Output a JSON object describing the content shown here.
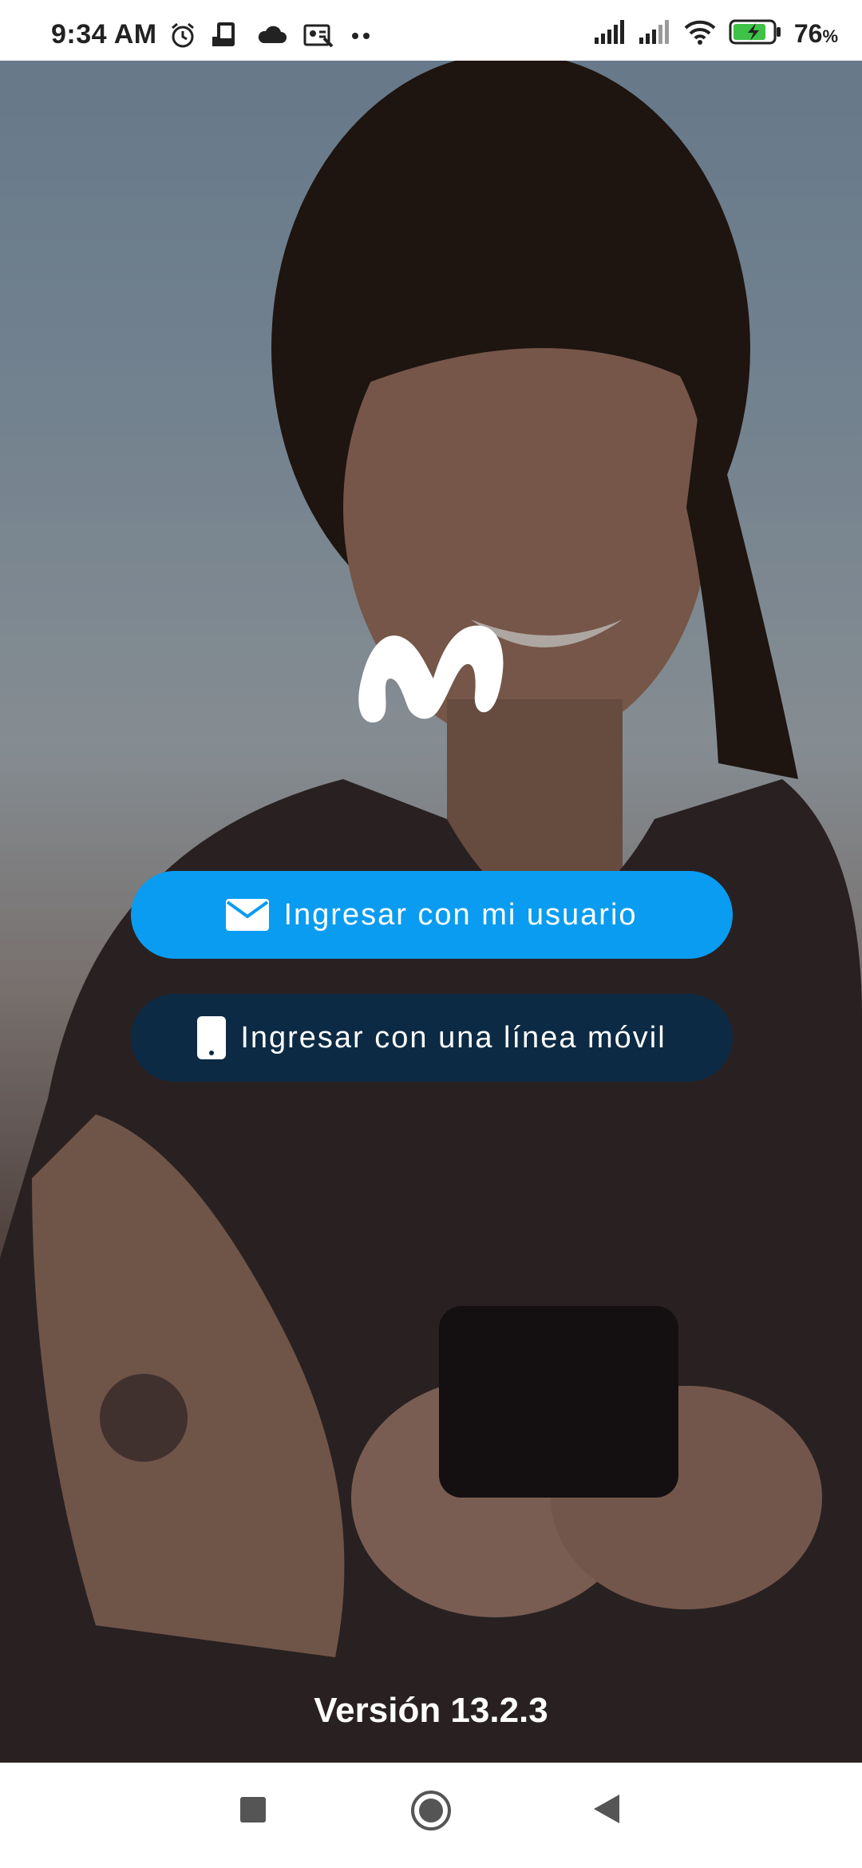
{
  "status_bar": {
    "time": "9:34 AM",
    "battery_percent": "76",
    "battery_unit": "%",
    "icons_left": [
      "alarm-icon",
      "phone-cast-icon",
      "cloud-icon",
      "contact-card-icon",
      "more-dots-icon"
    ],
    "icons_right": [
      "signal-icon",
      "signal-icon-2",
      "wifi-icon",
      "battery-charging-icon"
    ]
  },
  "app": {
    "logo": "movistar-m-logo",
    "buttons": {
      "user_login": "Ingresar con mi usuario",
      "line_login": "Ingresar con una línea móvil"
    },
    "version": "Versión 13.2.3"
  },
  "colors": {
    "primary_button": "#0a9cf0",
    "secondary_button": "#0c2a44"
  },
  "nav_bar": {
    "items": [
      "recent-apps-square-icon",
      "home-circle-icon",
      "back-triangle-icon"
    ]
  }
}
